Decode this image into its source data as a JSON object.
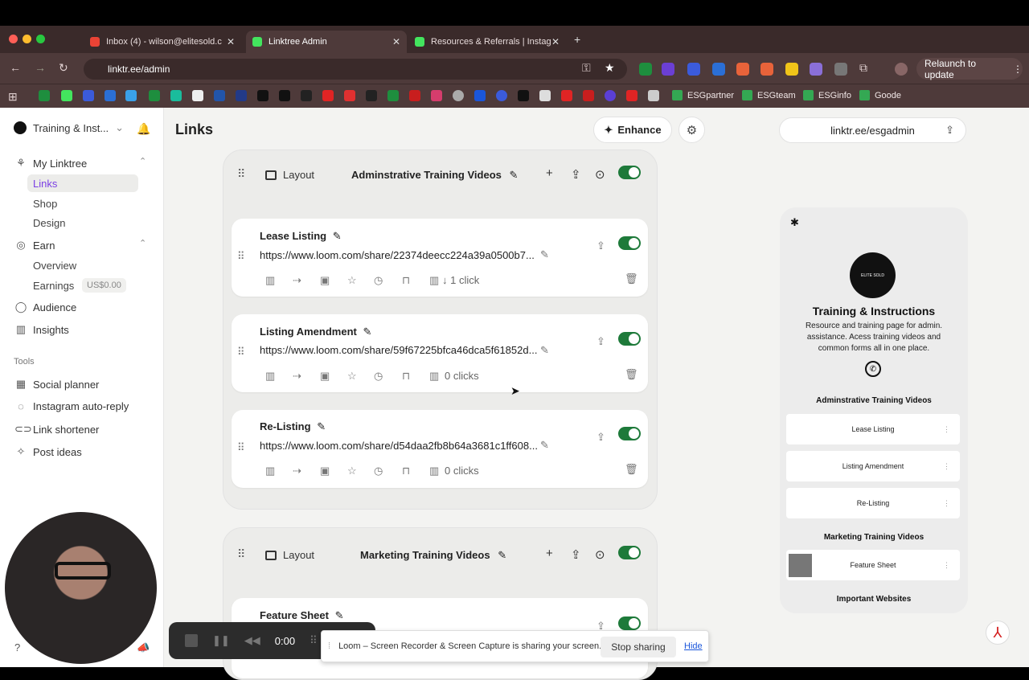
{
  "browser": {
    "tabs": [
      {
        "label": "Inbox (4) - wilson@elitesold.c"
      },
      {
        "label": "Linktree Admin"
      },
      {
        "label": "Resources & Referrals | Instag"
      }
    ],
    "address": "linktr.ee/admin",
    "relaunch_label": "Relaunch to update",
    "bookmarks": [
      "ESGpartner",
      "ESGteam",
      "ESGinfo",
      "Goode"
    ]
  },
  "sidebar": {
    "account": "Training & Inst...",
    "my_linktree": "My Linktree",
    "links": "Links",
    "shop": "Shop",
    "design": "Design",
    "earn": "Earn",
    "overview": "Overview",
    "earnings": "Earnings",
    "earnings_badge": "US$0.00",
    "audience": "Audience",
    "insights": "Insights",
    "tools_label": "Tools",
    "social_planner": "Social planner",
    "ig_autoreply": "Instagram auto-reply",
    "link_shortener": "Link shortener",
    "post_ideas": "Post ideas"
  },
  "header": {
    "title": "Links",
    "enhance": "Enhance",
    "profile_url": "linktr.ee/esgadmin"
  },
  "groups": [
    {
      "layout_label": "Layout",
      "title": "Adminstrative Training Videos"
    },
    {
      "layout_label": "Layout",
      "title": "Marketing Training Videos"
    }
  ],
  "cards": [
    {
      "title": "Lease Listing",
      "url": "https://www.loom.com/share/22374deecc224a39a0500b7...",
      "clicks": "↓ 1 click"
    },
    {
      "title": "Listing Amendment",
      "url": "https://www.loom.com/share/59f67225bfca46dca5f61852d...",
      "clicks": "0 clicks"
    },
    {
      "title": "Re-Listing",
      "url": "https://www.loom.com/share/d54daa2fb8b64a3681c1ff608...",
      "clicks": "0 clicks"
    },
    {
      "title": "Feature Sheet"
    }
  ],
  "preview": {
    "logo_text": "ELITE SOLD",
    "name": "Training & Instructions",
    "bio": "Resource and training page for admin. assistance. Acess training videos and common forms all in one place.",
    "sections": [
      "Adminstrative Training Videos",
      "Marketing Training Videos",
      "Important Websites"
    ],
    "buttons": [
      "Lease Listing",
      "Listing Amendment",
      "Re-Listing",
      "Feature Sheet"
    ]
  },
  "loom": {
    "time": "0:00",
    "share_msg": "Loom – Screen Recorder & Screen Capture is sharing your screen.",
    "stop": "Stop sharing",
    "hide": "Hide"
  }
}
